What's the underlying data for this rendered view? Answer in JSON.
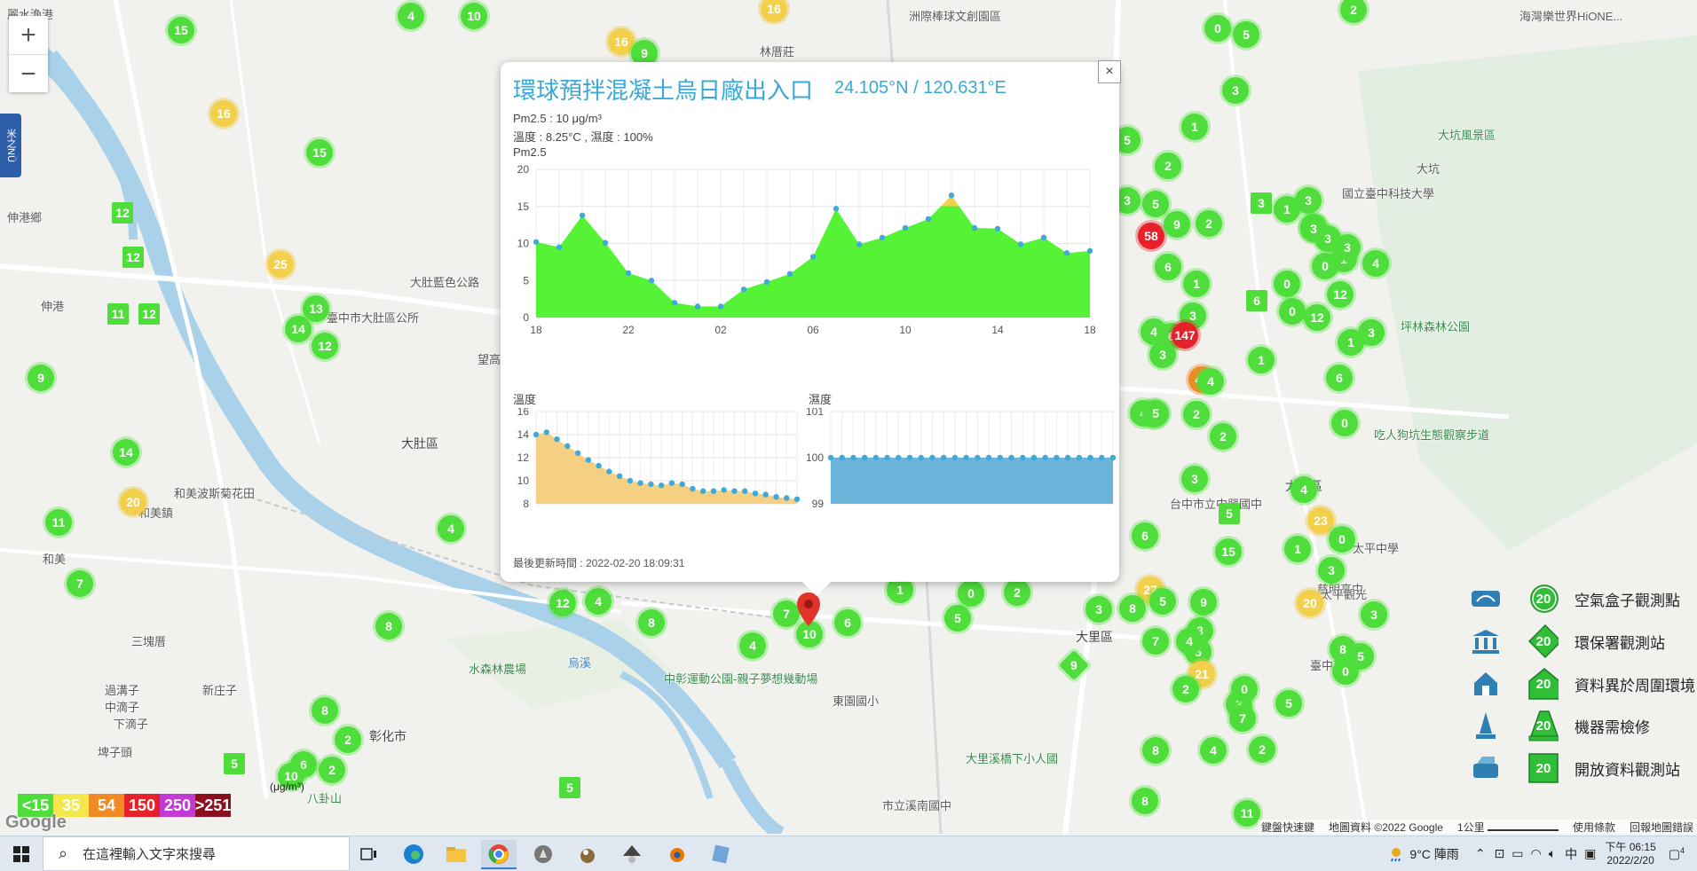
{
  "map": {
    "zoom_in": "+",
    "zoom_out": "−",
    "side_tab": "米之NÜ",
    "labels": [
      {
        "t": "麗水漁港",
        "c": ""
      },
      {
        "t": "伸港鄉",
        "c": ""
      },
      {
        "t": "伸港",
        "c": ""
      },
      {
        "t": "大肚區",
        "c": "big"
      },
      {
        "t": "和美鎮",
        "c": ""
      },
      {
        "t": "和美",
        "c": ""
      },
      {
        "t": "彰化市",
        "c": "big"
      },
      {
        "t": "大里區",
        "c": "big"
      },
      {
        "t": "太平區",
        "c": "big"
      },
      {
        "t": "林厝莊",
        "c": ""
      },
      {
        "t": "洲際棒球文創園區",
        "c": ""
      },
      {
        "t": "海灣樂世界HiONE...",
        "c": ""
      },
      {
        "t": "大坑風景區",
        "c": "green"
      },
      {
        "t": "國立臺中科技大學",
        "c": ""
      },
      {
        "t": "坪林森林公園",
        "c": "green"
      },
      {
        "t": "吃人狗坑生態觀察步道",
        "c": "green"
      },
      {
        "t": "水森林農場",
        "c": "green"
      },
      {
        "t": "中彰運動公園-親子夢想幾動場",
        "c": "green"
      },
      {
        "t": "東園國小",
        "c": ""
      },
      {
        "t": "大里溪橋下小人國",
        "c": "green"
      },
      {
        "t": "市立溪南國中",
        "c": ""
      },
      {
        "t": "台中市立中興國中",
        "c": ""
      },
      {
        "t": "慈明高中",
        "c": ""
      },
      {
        "t": "臺中東體",
        "c": ""
      },
      {
        "t": "八卦山",
        "c": "green"
      },
      {
        "t": "和美波斯菊花田",
        "c": ""
      },
      {
        "t": "大肚藍色公路",
        "c": ""
      },
      {
        "t": "臺中市大肚區公所",
        "c": ""
      },
      {
        "t": "三塊厝",
        "c": ""
      },
      {
        "t": "新庄子",
        "c": ""
      },
      {
        "t": "過溝子",
        "c": ""
      },
      {
        "t": "中滴子",
        "c": ""
      },
      {
        "t": "下滴子",
        "c": ""
      },
      {
        "t": "埤子頭",
        "c": ""
      },
      {
        "t": "太平觀光",
        "c": ""
      },
      {
        "t": "大坑",
        "c": ""
      },
      {
        "t": "太平中學",
        "c": ""
      },
      {
        "t": "望高寮",
        "c": ""
      },
      {
        "t": "烏溪",
        "c": "blue"
      }
    ],
    "markers": [
      {
        "v": "15",
        "c": "g"
      },
      {
        "v": "4",
        "c": "g"
      },
      {
        "v": "10",
        "c": "g"
      },
      {
        "v": "16",
        "c": "y"
      },
      {
        "v": "16",
        "c": "y"
      },
      {
        "v": "9",
        "c": "g"
      },
      {
        "v": "16",
        "c": "y"
      },
      {
        "v": "15",
        "c": "g"
      },
      {
        "v": "12",
        "c": "g sq"
      },
      {
        "v": "12",
        "c": "g sq"
      },
      {
        "v": "25",
        "c": "y"
      },
      {
        "v": "11",
        "c": "g sq"
      },
      {
        "v": "12",
        "c": "g sq"
      },
      {
        "v": "13",
        "c": "g"
      },
      {
        "v": "14",
        "c": "g"
      },
      {
        "v": "12",
        "c": "g"
      },
      {
        "v": "9",
        "c": "g"
      },
      {
        "v": "14",
        "c": "g"
      },
      {
        "v": "20",
        "c": "y"
      },
      {
        "v": "11",
        "c": "g"
      },
      {
        "v": "4",
        "c": "g"
      },
      {
        "v": "7",
        "c": "g"
      },
      {
        "v": "8",
        "c": "g"
      },
      {
        "v": "8",
        "c": "g"
      },
      {
        "v": "2",
        "c": "g"
      },
      {
        "v": "5",
        "c": "g sq"
      },
      {
        "v": "6",
        "c": "g"
      },
      {
        "v": "10",
        "c": "g"
      },
      {
        "v": "2",
        "c": "g"
      },
      {
        "v": "12",
        "c": "g"
      },
      {
        "v": "4",
        "c": "g"
      },
      {
        "v": "8",
        "c": "g"
      },
      {
        "v": "5",
        "c": "g sq"
      },
      {
        "v": "4",
        "c": "g"
      },
      {
        "v": "7",
        "c": "g"
      },
      {
        "v": "10",
        "c": "g"
      },
      {
        "v": "6",
        "c": "g"
      },
      {
        "v": "1",
        "c": "g"
      },
      {
        "v": "0",
        "c": "g"
      },
      {
        "v": "5",
        "c": "g"
      },
      {
        "v": "2",
        "c": "g"
      },
      {
        "v": "3",
        "c": "g"
      },
      {
        "v": "27",
        "c": "y"
      },
      {
        "v": "9",
        "c": "g"
      },
      {
        "v": "8",
        "c": "g"
      },
      {
        "v": "3",
        "c": "g"
      },
      {
        "v": "7",
        "c": "g"
      },
      {
        "v": "5",
        "c": "g"
      },
      {
        "v": "21",
        "c": "y"
      },
      {
        "v": "2",
        "c": "g"
      },
      {
        "v": "8",
        "c": "g"
      },
      {
        "v": "4",
        "c": "g"
      },
      {
        "v": "8",
        "c": "g"
      },
      {
        "v": "11",
        "c": "g"
      },
      {
        "v": "9",
        "c": "g dia"
      },
      {
        "v": "0",
        "c": "g"
      },
      {
        "v": "5",
        "c": "g"
      },
      {
        "v": "2",
        "c": "g"
      },
      {
        "v": "3",
        "c": "g"
      },
      {
        "v": "1",
        "c": "g"
      },
      {
        "v": "5",
        "c": "g"
      },
      {
        "v": "2",
        "c": "g"
      },
      {
        "v": "3",
        "c": "g"
      },
      {
        "v": "58",
        "c": "r"
      },
      {
        "v": "5",
        "c": "g"
      },
      {
        "v": "9",
        "c": "g"
      },
      {
        "v": "6",
        "c": "g"
      },
      {
        "v": "1",
        "c": "g"
      },
      {
        "v": "2",
        "c": "g"
      },
      {
        "v": "3",
        "c": "g sq"
      },
      {
        "v": "1",
        "c": "g"
      },
      {
        "v": "3",
        "c": "g"
      },
      {
        "v": "0",
        "c": "g"
      },
      {
        "v": "3",
        "c": "g"
      },
      {
        "v": "0",
        "c": "g"
      },
      {
        "v": "0",
        "c": "g"
      },
      {
        "v": "4",
        "c": "g"
      },
      {
        "v": "1",
        "c": "g"
      },
      {
        "v": "3",
        "c": "g"
      },
      {
        "v": "3",
        "c": "g"
      },
      {
        "v": "12",
        "c": "g"
      },
      {
        "v": "4",
        "c": "g"
      },
      {
        "v": "3",
        "c": "g"
      },
      {
        "v": "6",
        "c": "g"
      },
      {
        "v": "12",
        "c": "g"
      },
      {
        "v": "0",
        "c": "g"
      },
      {
        "v": "3",
        "c": "g"
      },
      {
        "v": "1",
        "c": "g"
      },
      {
        "v": "6",
        "c": "g"
      },
      {
        "v": "42",
        "c": "o"
      },
      {
        "v": "1",
        "c": "g"
      },
      {
        "v": "4",
        "c": "g"
      },
      {
        "v": "3",
        "c": "g"
      },
      {
        "v": "6",
        "c": "g sq"
      },
      {
        "v": "5",
        "c": "g"
      },
      {
        "v": "2",
        "c": "g"
      },
      {
        "v": "2",
        "c": "g"
      },
      {
        "v": "3",
        "c": "g"
      },
      {
        "v": "6",
        "c": "g"
      },
      {
        "v": "4",
        "c": "g"
      },
      {
        "v": "0",
        "c": "g"
      },
      {
        "v": "23",
        "c": "y"
      },
      {
        "v": "147",
        "c": "r"
      },
      {
        "v": "5",
        "c": "g sq"
      },
      {
        "v": "5",
        "c": "g"
      },
      {
        "v": "1",
        "c": "g"
      },
      {
        "v": "4",
        "c": "g"
      },
      {
        "v": "15",
        "c": "g"
      },
      {
        "v": "0",
        "c": "g"
      },
      {
        "v": "20",
        "c": "y"
      },
      {
        "v": "8",
        "c": "g"
      },
      {
        "v": "3",
        "c": "g"
      },
      {
        "v": "3",
        "c": "g"
      },
      {
        "v": "0",
        "c": "g"
      },
      {
        "v": "5",
        "c": "g"
      },
      {
        "v": "3",
        "c": "g"
      },
      {
        "v": "2",
        "c": "g"
      },
      {
        "v": "5",
        "c": "g"
      },
      {
        "v": "0",
        "c": "g"
      },
      {
        "v": "5",
        "c": "g"
      },
      {
        "v": "4",
        "c": "g"
      },
      {
        "v": "7",
        "c": "g"
      }
    ]
  },
  "popup": {
    "close": "×",
    "title": "環球預拌混凝土烏日廠出入口",
    "coords": "24.105°N / 120.631°E",
    "pm25_line": "Pm2.5 : 10 μg/m³",
    "temp_line": "溫度 : 8.25°C , 濕度 : 100%",
    "chart_label": "Pm2.5",
    "temp_label": "溫度",
    "hum_label": "濕度",
    "updated": "最後更新時間 : 2022-02-20 18:09:31"
  },
  "chart_data": [
    {
      "type": "area",
      "title": "Pm2.5",
      "x_ticks": [
        "18",
        "22",
        "02",
        "06",
        "10",
        "14",
        "18"
      ],
      "y_ticks": [
        0,
        5,
        10,
        15,
        20
      ],
      "ylim": [
        0,
        20
      ],
      "values": [
        10.2,
        9.5,
        13.8,
        10.1,
        6.0,
        5.0,
        2.0,
        1.5,
        1.5,
        3.8,
        4.8,
        5.9,
        8.2,
        14.7,
        9.9,
        10.8,
        12.1,
        13.3,
        16.5,
        12.1,
        12.0,
        9.9,
        10.8,
        8.7,
        9.0
      ],
      "colors": {
        "normal": "#55f235",
        "moderate": "#f2d04c",
        "points": "#3fa9d8"
      },
      "threshold": 15
    },
    {
      "type": "area",
      "title": "溫度",
      "y_ticks": [
        8,
        10,
        12,
        14,
        16
      ],
      "ylim": [
        8,
        16
      ],
      "values": [
        14.0,
        14.2,
        13.6,
        13.0,
        12.4,
        11.8,
        11.3,
        10.8,
        10.4,
        10.0,
        9.8,
        9.7,
        9.6,
        9.8,
        9.7,
        9.3,
        9.1,
        9.1,
        9.2,
        9.1,
        9.1,
        8.9,
        8.8,
        8.6,
        8.5,
        8.4
      ],
      "colors": {
        "fill": "#f5cf82",
        "points": "#3fa9d8"
      }
    },
    {
      "type": "area",
      "title": "濕度",
      "y_ticks": [
        99,
        100,
        101
      ],
      "ylim": [
        99,
        101
      ],
      "values": [
        100,
        100,
        100,
        100,
        100,
        100,
        100,
        100,
        100,
        100,
        100,
        100,
        100,
        100,
        100,
        100,
        100,
        100,
        100,
        100,
        100,
        100,
        100,
        100,
        100,
        100
      ],
      "colors": {
        "fill": "#6ab3d9",
        "points": "#3fa9d8"
      }
    }
  ],
  "legend": {
    "items": [
      {
        "label": "空氣盒子觀測點",
        "value": "20",
        "shape": "circle"
      },
      {
        "label": "環保署觀測站",
        "value": "20",
        "shape": "diamond"
      },
      {
        "label": "資料異於周圍環境",
        "value": "20",
        "shape": "house"
      },
      {
        "label": "機器需檢修",
        "value": "20",
        "shape": "cone"
      },
      {
        "label": "開放資料觀測站",
        "value": "20",
        "shape": "square"
      }
    ]
  },
  "aqi_scale": {
    "unit": "(μg/m³)",
    "levels": [
      {
        "label": "<15",
        "color": "#4fdd3b"
      },
      {
        "label": "35",
        "color": "#f2e84c"
      },
      {
        "label": "54",
        "color": "#f08a24"
      },
      {
        "label": "150",
        "color": "#e8202a"
      },
      {
        "label": "250",
        "color": "#c23ad6"
      },
      {
        "label": ">251",
        "color": "#8a1020"
      }
    ]
  },
  "attribution": {
    "google": "Google",
    "shortcuts": "鍵盤快速鍵",
    "mapdata": "地圖資料 ©2022 Google",
    "scale": "1公里",
    "terms": "使用條款",
    "report": "回報地圖錯誤"
  },
  "taskbar": {
    "search_placeholder": "在這裡輸入文字來搜尋",
    "weather": "9°C  陣雨",
    "ime": "中",
    "time": "下午 06:15",
    "date": "2022/2/20",
    "notifications": "4"
  }
}
